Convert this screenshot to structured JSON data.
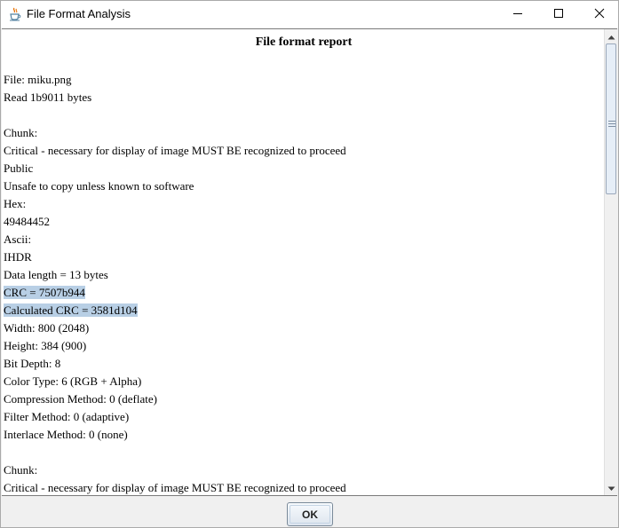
{
  "window": {
    "title": "File Format Analysis",
    "icons": {
      "app": "java-cup-icon",
      "minimize": "minimize-icon",
      "maximize": "maximize-icon",
      "close": "close-icon"
    }
  },
  "report": {
    "title": "File format report",
    "lines": [
      "File: miku.png",
      "Read 1b9011 bytes",
      "",
      "Chunk:",
      "Critical - necessary for display of image MUST BE recognized to proceed",
      "Public",
      "Unsafe to copy unless known to software",
      "Hex:",
      "49484452",
      "Ascii:",
      "IHDR",
      "Data length = 13 bytes",
      "CRC = 7507b944",
      "Calculated CRC = 3581d104",
      "Width: 800 (2048)",
      "Height: 384 (900)",
      "Bit Depth: 8",
      "Color Type: 6 (RGB + Alpha)",
      "Compression Method: 0 (deflate)",
      "Filter Method: 0 (adaptive)",
      "Interlace Method: 0 (none)",
      "",
      "Chunk:",
      "Critical - necessary for display of image MUST BE recognized to proceed"
    ],
    "selected_lines": [
      12,
      13
    ]
  },
  "footer": {
    "ok_label": "OK"
  },
  "colors": {
    "selection": "#b8cfe5",
    "background": "#ffffff",
    "chrome": "#f0f0f0"
  }
}
